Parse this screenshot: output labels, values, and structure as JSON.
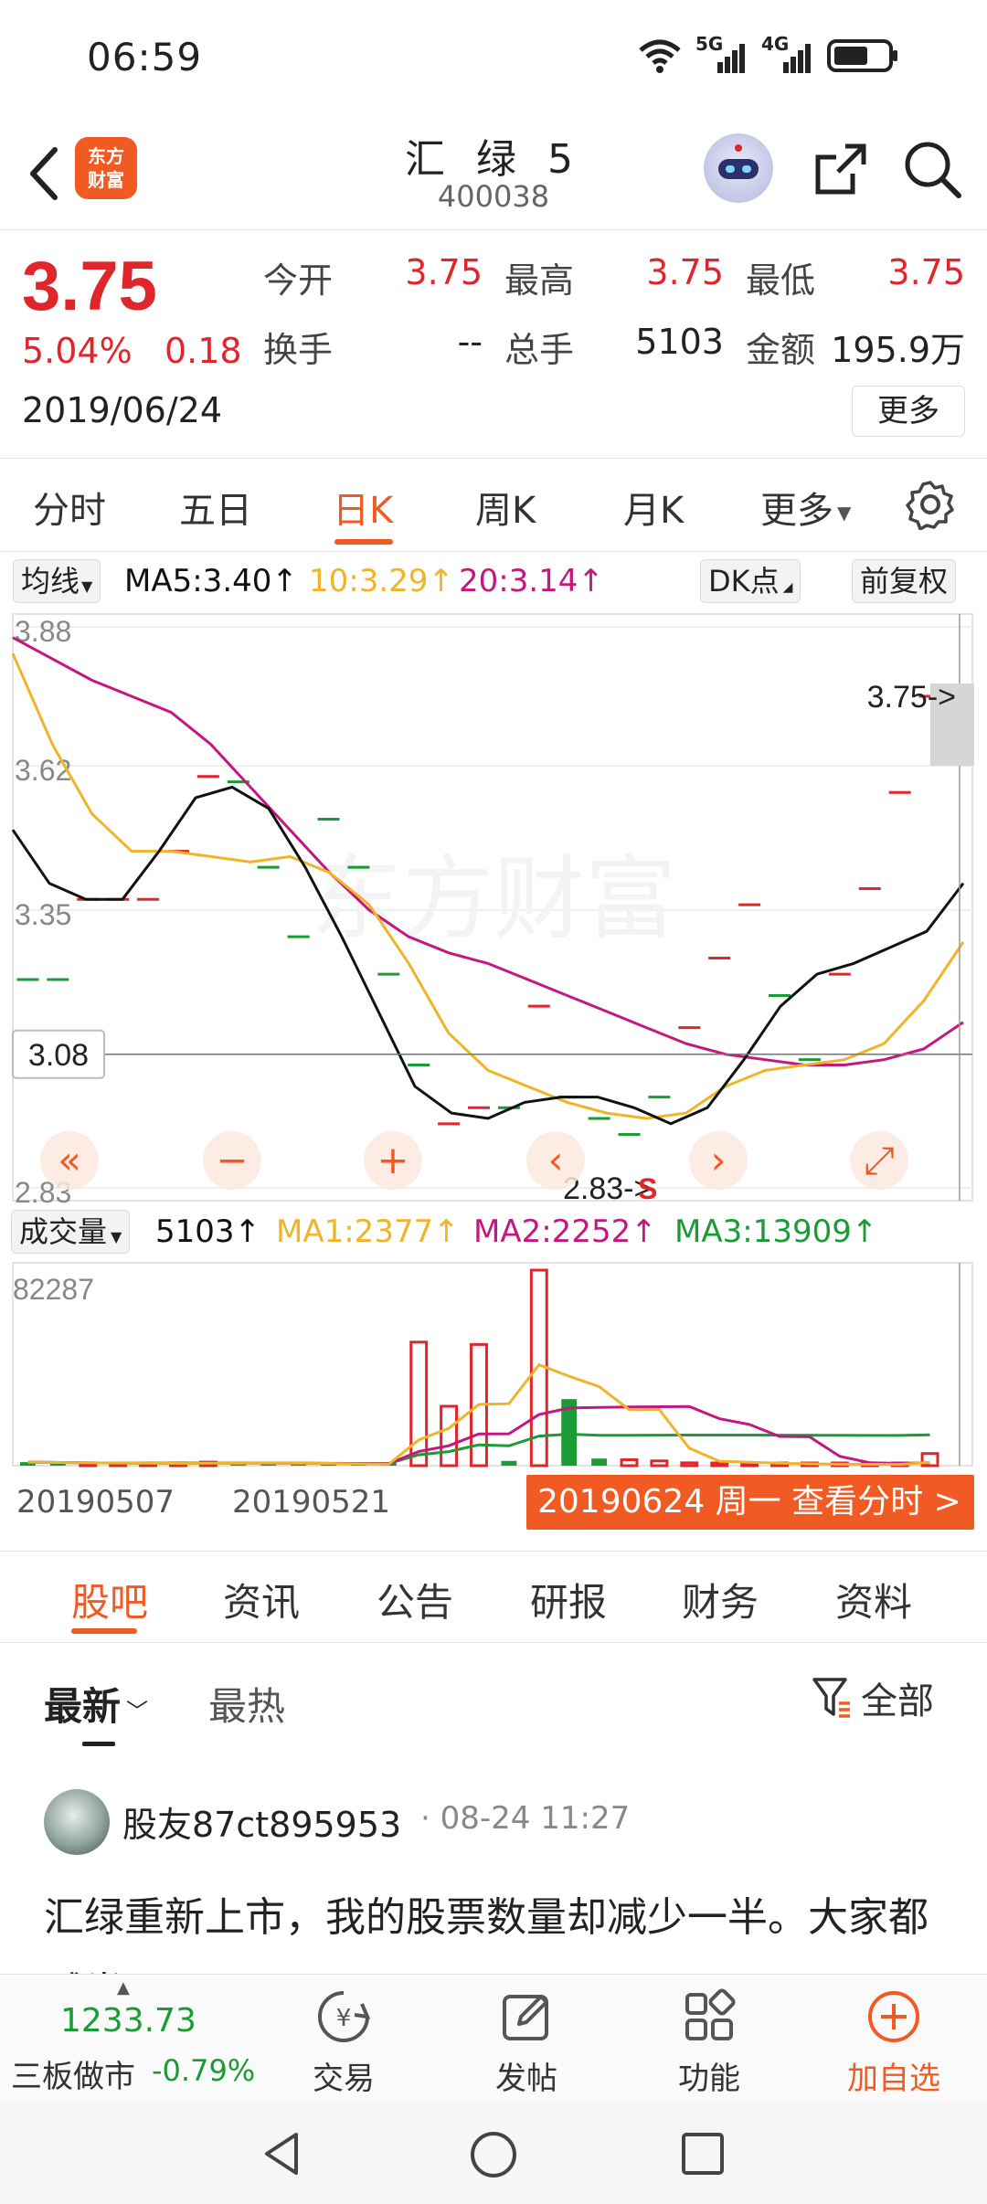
{
  "status_bar": {
    "time": "06:59",
    "signal1": "5G",
    "signal2": "4G"
  },
  "header": {
    "logo_text": "东方财富",
    "title": "汇 绿 5",
    "code": "400038"
  },
  "quote": {
    "price": "3.75",
    "change_pct": "5.04%",
    "change": "0.18",
    "date": "2019/06/24",
    "open_label": "今开",
    "open": "3.75",
    "high_label": "最高",
    "high": "3.75",
    "low_label": "最低",
    "low": "3.75",
    "turnover_label": "换手",
    "turnover": "--",
    "volume_label": "总手",
    "volume": "5103",
    "amount_label": "金额",
    "amount": "195.9万",
    "more_label": "更多"
  },
  "period_tabs": [
    "分时",
    "五日",
    "日K",
    "周K",
    "月K",
    "更多"
  ],
  "ma_legend": {
    "selector": "均线",
    "ma5": "MA5:3.40↑",
    "ma10": "10:3.29↑",
    "ma20": "20:3.14↑",
    "dk": "DK点",
    "adjust": "前复权"
  },
  "kchart": {
    "y_labels": [
      "3.88",
      "3.62",
      "3.35",
      "3.08",
      "2.83"
    ],
    "current_label": "3.08",
    "max_label": "3.75->",
    "min_label": "2.83->",
    "signal": "S",
    "watermark": "东方财富"
  },
  "volume_legend": {
    "selector": "成交量",
    "vol": "5103↑",
    "ma1": "MA1:2377↑",
    "ma2": "MA2:2252↑",
    "ma3": "MA3:13909↑",
    "max_label": "82287"
  },
  "date_axis": {
    "d1": "20190507",
    "d2": "20190521",
    "selected": "20190624 周一 查看分时 >"
  },
  "content_tabs": [
    "股吧",
    "资讯",
    "公告",
    "研报",
    "财务",
    "资料"
  ],
  "filter": {
    "newest": "最新",
    "hottest": "最热",
    "all": "全部"
  },
  "post": {
    "author": "股友87ct895953",
    "time": "· 08-24 11:27",
    "body": "汇绿重新上市，我的股票数量却减少一半。大家都减半了吗？"
  },
  "action_bar": {
    "index_value": "1233.73",
    "index_name": "三板做市",
    "index_change": "-0.79%",
    "trade": "交易",
    "post": "发帖",
    "functions": "功能",
    "add_watch": "加自选"
  },
  "colors": {
    "up": "#e0252b",
    "down": "#1a9b35",
    "accent": "#f15a22",
    "ma5": "#111111",
    "ma10": "#f0b429",
    "ma20": "#c2187f"
  },
  "chart_data": {
    "type": "candlestick",
    "price_range": [
      2.83,
      3.88
    ],
    "volume_max": 82287,
    "candles": [
      {
        "c": 3.22,
        "up": false
      },
      {
        "c": 3.22,
        "up": false
      },
      {
        "c": 3.37,
        "up": true
      },
      {
        "c": 3.37,
        "up": true
      },
      {
        "c": 3.37,
        "up": true
      },
      {
        "c": 3.46,
        "up": true
      },
      {
        "c": 3.6,
        "up": true
      },
      {
        "c": 3.59,
        "up": false
      },
      {
        "c": 3.43,
        "up": false
      },
      {
        "c": 3.3,
        "up": false
      },
      {
        "c": 3.52,
        "up": false
      },
      {
        "c": 3.43,
        "up": false
      },
      {
        "c": 3.23,
        "up": false
      },
      {
        "c": 3.06,
        "up": false
      },
      {
        "c": 2.95,
        "up": true
      },
      {
        "c": 2.98,
        "up": true
      },
      {
        "c": 2.98,
        "up": false
      },
      {
        "c": 3.17,
        "up": true
      },
      {
        "c": 3.0,
        "up": false
      },
      {
        "c": 2.96,
        "up": false
      },
      {
        "c": 2.93,
        "up": false
      },
      {
        "c": 3.0,
        "up": false
      },
      {
        "c": 3.13,
        "up": true
      },
      {
        "c": 3.26,
        "up": true
      },
      {
        "c": 3.36,
        "up": true
      },
      {
        "c": 3.19,
        "up": false
      },
      {
        "c": 3.07,
        "up": false
      },
      {
        "c": 3.23,
        "up": true
      },
      {
        "c": 3.39,
        "up": true
      },
      {
        "c": 3.57,
        "up": true
      },
      {
        "c": 3.75,
        "up": true
      }
    ],
    "ma5": [
      3.5,
      3.4,
      3.37,
      3.37,
      3.46,
      3.56,
      3.58,
      3.54,
      3.43,
      3.3,
      3.16,
      3.02,
      2.97,
      2.96,
      2.99,
      3.0,
      3.0,
      2.98,
      2.95,
      2.98,
      3.07,
      3.17,
      3.23,
      3.25,
      3.28,
      3.31,
      3.4
    ],
    "ma10": [
      3.83,
      3.66,
      3.53,
      3.46,
      3.46,
      3.45,
      3.44,
      3.45,
      3.42,
      3.36,
      3.25,
      3.12,
      3.05,
      3.02,
      2.99,
      2.97,
      2.96,
      2.97,
      3.02,
      3.05,
      3.06,
      3.07,
      3.1,
      3.18,
      3.29
    ],
    "ma20": [
      3.86,
      3.82,
      3.78,
      3.75,
      3.72,
      3.66,
      3.58,
      3.5,
      3.42,
      3.35,
      3.3,
      3.27,
      3.25,
      3.22,
      3.19,
      3.16,
      3.13,
      3.1,
      3.08,
      3.07,
      3.06,
      3.06,
      3.07,
      3.09,
      3.14
    ],
    "volumes": [
      {
        "v": 1500,
        "up": false
      },
      {
        "v": 1200,
        "up": false
      },
      {
        "v": 900,
        "up": true
      },
      {
        "v": 800,
        "up": true
      },
      {
        "v": 800,
        "up": true
      },
      {
        "v": 1100,
        "up": true
      },
      {
        "v": 1500,
        "up": true
      },
      {
        "v": 1200,
        "up": false
      },
      {
        "v": 900,
        "up": false
      },
      {
        "v": 700,
        "up": false
      },
      {
        "v": 600,
        "up": false
      },
      {
        "v": 500,
        "up": false
      },
      {
        "v": 400,
        "up": false
      },
      {
        "v": 52000,
        "up": true
      },
      {
        "v": 25000,
        "up": true
      },
      {
        "v": 51000,
        "up": true
      },
      {
        "v": 2000,
        "up": false
      },
      {
        "v": 82287,
        "up": true
      },
      {
        "v": 28000,
        "up": false
      },
      {
        "v": 3000,
        "up": false
      },
      {
        "v": 2500,
        "up": true
      },
      {
        "v": 2000,
        "up": true
      },
      {
        "v": 1200,
        "up": true
      },
      {
        "v": 800,
        "up": true
      },
      {
        "v": 600,
        "up": true
      },
      {
        "v": 700,
        "up": true
      },
      {
        "v": 500,
        "up": true
      },
      {
        "v": 400,
        "up": true
      },
      {
        "v": 600,
        "up": true
      },
      {
        "v": 500,
        "up": true
      },
      {
        "v": 5103,
        "up": true
      }
    ]
  }
}
